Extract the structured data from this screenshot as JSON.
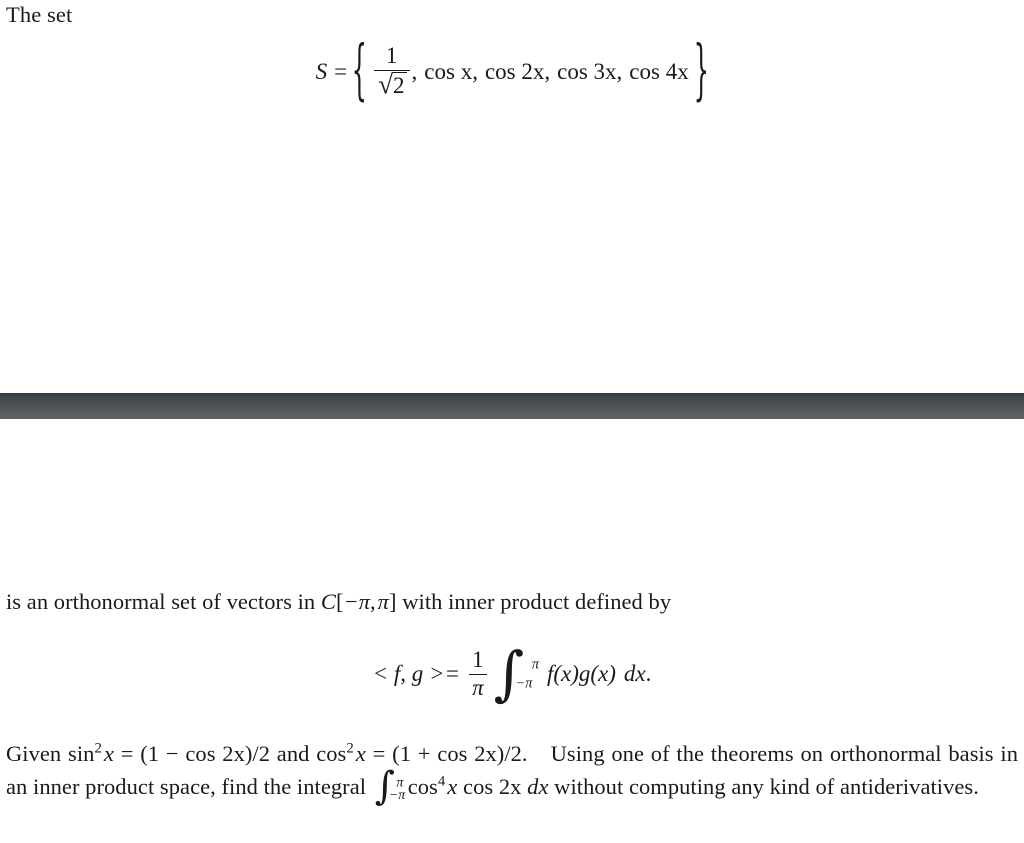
{
  "document": {
    "intro": "The set",
    "set_definition": {
      "symbol": "S",
      "equals": "=",
      "open_brace": "{",
      "close_brace": "}",
      "first_element": {
        "numerator": "1",
        "radical": "√",
        "radicand": "2"
      },
      "separator": ",",
      "elements": [
        "cos x",
        "cos 2x",
        "cos 3x",
        "cos 4x"
      ],
      "plain": "S = { 1/√2, cos x, cos 2x, cos 3x, cos 4x }"
    },
    "orthonormal_sentence": {
      "before_space": "is an orthonormal set of vectors in",
      "space_name": "C",
      "space_open": "[",
      "space_lower": "−π",
      "space_comma": ",",
      "space_upper": "π",
      "space_close": "]",
      "after_space": "with inner product defined by",
      "plain": "is an orthonormal set of vectors in C[−π, π] with inner product defined by"
    },
    "inner_product_formula": {
      "lhs": "< f, g >=",
      "fraction": {
        "numerator": "1",
        "denominator": "π"
      },
      "integral_sign": "∫",
      "upper_limit": "π",
      "lower_limit": "−π",
      "integrand": "f(x)g(x)",
      "differential": "dx",
      "period": ".",
      "plain": "< f, g >= (1/π) ∫_{−π}^{π} f(x)g(x) dx."
    },
    "given_paragraph": {
      "given_word": "Given",
      "identity_sin": {
        "function": "sin",
        "exponent": "2",
        "variable": "x",
        "equals": "=",
        "rhs": "(1 − cos 2x)/2"
      },
      "conjunction": "and",
      "identity_cos": {
        "function": "cos",
        "exponent": "2",
        "variable": "x",
        "equals": "=",
        "rhs": "(1 + cos 2x)/2."
      },
      "instruction_part1": "Using one of the theorems on orthonormal basis in an inner product space, find the integral",
      "target_integral": {
        "integral_sign": "∫",
        "upper_limit": "π",
        "lower_limit": "−π",
        "function": "cos",
        "exponent": "4",
        "variable": "x",
        "second_factor": "cos 2x",
        "differential": "dx"
      },
      "instruction_part2": "without computing any kind of antiderivatives.",
      "plain": "Given sin² x = (1 − cos 2x)/2 and cos² x = (1 + cos 2x)/2. Using one of the theorems on orthonormal basis in an inner product space, find the integral ∫_{−π}^{π} cos⁴ x cos 2x dx without computing any kind of antiderivatives."
    }
  },
  "style": {
    "page_background": "#ffffff",
    "text_color": "#1a1a1a",
    "separator_bar_color": "#4e5457"
  }
}
